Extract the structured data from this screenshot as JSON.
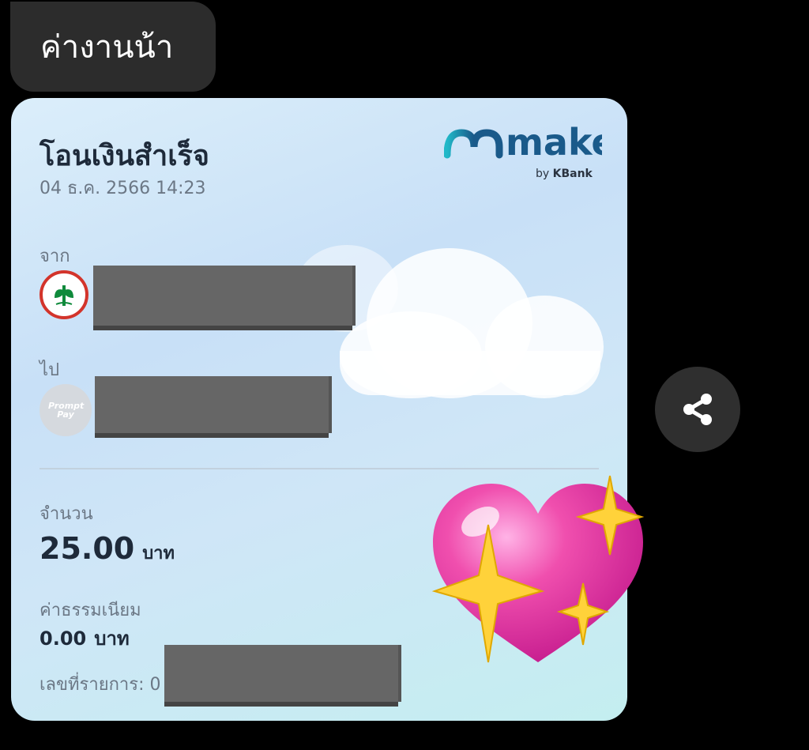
{
  "chat": {
    "message_text": "ค่างานน้า"
  },
  "slip": {
    "title": "โอนเงินสำเร็จ",
    "datetime": "04 ธ.ค. 2566 14:23",
    "logo": {
      "text": "make",
      "by": "by",
      "brand": "KBank"
    },
    "from": {
      "label": "จาก",
      "bank_icon": "kbank-leaf-icon"
    },
    "to": {
      "label": "ไป",
      "icon": "promptpay-icon",
      "icon_text": "Prompt Pay"
    },
    "amount": {
      "label": "จำนวน",
      "value": "25.00",
      "unit": "บาท"
    },
    "fee": {
      "label": "ค่าธรรมเนียม",
      "value": "0.00",
      "unit": "บาท"
    },
    "reference": {
      "label": "เลขที่รายการ: 0"
    }
  },
  "share_button": {
    "icon": "share-icon"
  },
  "sticker": {
    "icon": "sparkling-heart-icon"
  },
  "colors": {
    "background": "#000000",
    "bubble": "#2c2c2c",
    "logo_blue": "#1a5a8a",
    "logo_teal": "#21b8c8",
    "kbank_green": "#0f8a3b",
    "kbank_red": "#d3342b",
    "heart_pink": "#f04fae",
    "sparkle_yellow": "#ffd23a"
  }
}
